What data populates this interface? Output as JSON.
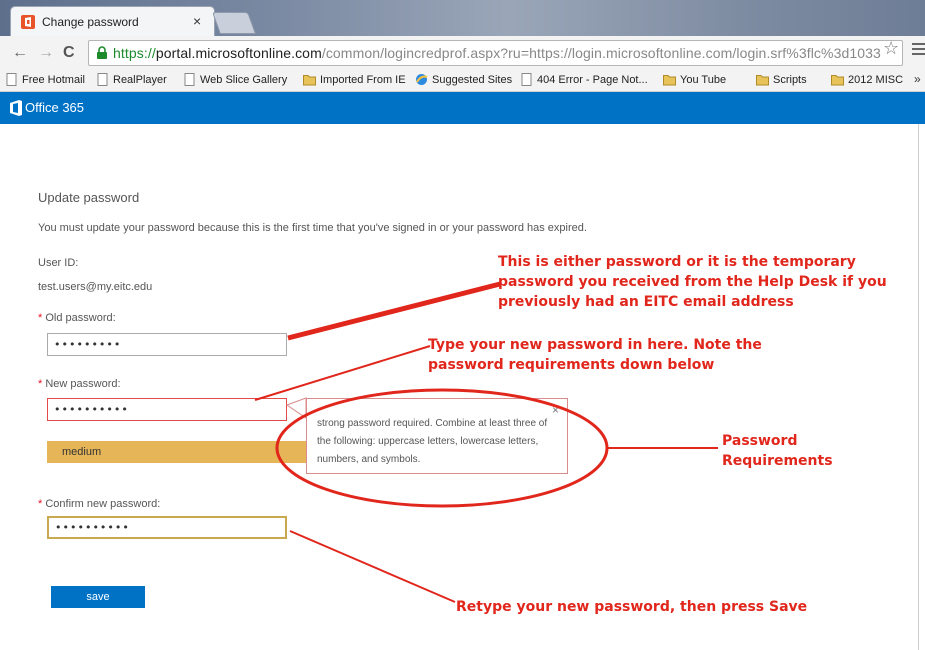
{
  "browser": {
    "tab": {
      "title": "Change password",
      "close": "×"
    },
    "nav": {
      "back": "←",
      "forward": "→",
      "reload": "C"
    },
    "url": {
      "scheme": "https://",
      "host": "portal.microsoftonline.com",
      "path": "/common/logincredprof.aspx?ru=https://login.microsoftonline.com/login.srf%3flc%3d1033"
    },
    "star": "☆",
    "bookmarks": [
      {
        "label": "Free Hotmail",
        "icon": "page-icon"
      },
      {
        "label": "RealPlayer",
        "icon": "page-icon"
      },
      {
        "label": "Web Slice Gallery",
        "icon": "page-icon"
      },
      {
        "label": "Imported From IE",
        "icon": "folder-icon"
      },
      {
        "label": "Suggested Sites",
        "icon": "ie-icon"
      },
      {
        "label": "404 Error - Page Not...",
        "icon": "page-icon"
      },
      {
        "label": "You Tube",
        "icon": "folder-icon"
      },
      {
        "label": "Scripts",
        "icon": "folder-icon"
      },
      {
        "label": "2012 MISC",
        "icon": "folder-icon"
      }
    ],
    "bookmarks_overflow": "»"
  },
  "header": {
    "brand": "Office 365",
    "color": "#0072c6"
  },
  "form": {
    "title": "Update password",
    "intro": "You must update your password because this is the first time that you've signed in or your password has expired.",
    "userid_label": "User ID:",
    "userid_value": "test.users@my.eitc.edu",
    "required_mark": "*",
    "old_label": "Old password:",
    "old_value": "•••••••••",
    "new_label": "New password:",
    "new_value": "••••••••••",
    "strength": "medium",
    "strength_color": "#e5b557",
    "tooltip_text": "strong password required. Combine at least three of the following: uppercase letters, lowercase letters, numbers, and symbols.",
    "tooltip_close": "×",
    "confirm_label": "Confirm new password:",
    "confirm_value": "••••••••••",
    "save_label": "save"
  },
  "annotations": {
    "old": "This is either password or it is the temporary password you received from the Help Desk if you previously had an EITC email address",
    "new": "Type your new password in here.  Note the password requirements down below",
    "requirements": "Password Requirements",
    "confirm": "Retype your new password, then press Save",
    "color": "#e1261c"
  }
}
